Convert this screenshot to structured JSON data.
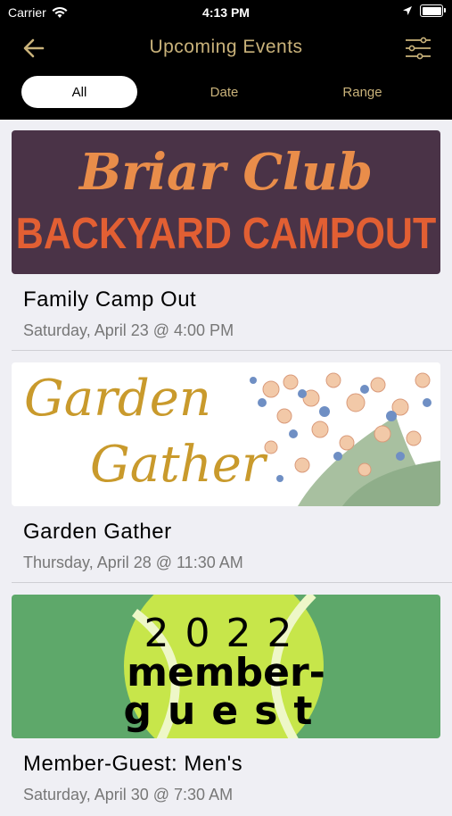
{
  "status_bar": {
    "carrier": "Carrier",
    "time": "4:13 PM"
  },
  "nav": {
    "title": "Upcoming Events"
  },
  "segments": [
    {
      "label": "All",
      "active": true
    },
    {
      "label": "Date",
      "active": false
    },
    {
      "label": "Range",
      "active": false
    }
  ],
  "events": [
    {
      "title": "Family Camp Out",
      "date": "Saturday, April 23 @ 4:00 PM",
      "banner_line1": "Briar Club",
      "banner_line2": "BACKYARD CAMPOUT"
    },
    {
      "title": "Garden Gather",
      "date": "Thursday, April 28 @ 11:30 AM",
      "banner_line1": "Garden",
      "banner_line2": "Gather"
    },
    {
      "title": "Member-Guest: Men's",
      "date": "Saturday, April 30 @ 7:30 AM",
      "banner_line1": "2022",
      "banner_line2": "member-",
      "banner_line3": "guest"
    }
  ],
  "colors": {
    "accent": "#c9b27a",
    "header_bg": "#000000",
    "page_bg": "#efeff4"
  }
}
